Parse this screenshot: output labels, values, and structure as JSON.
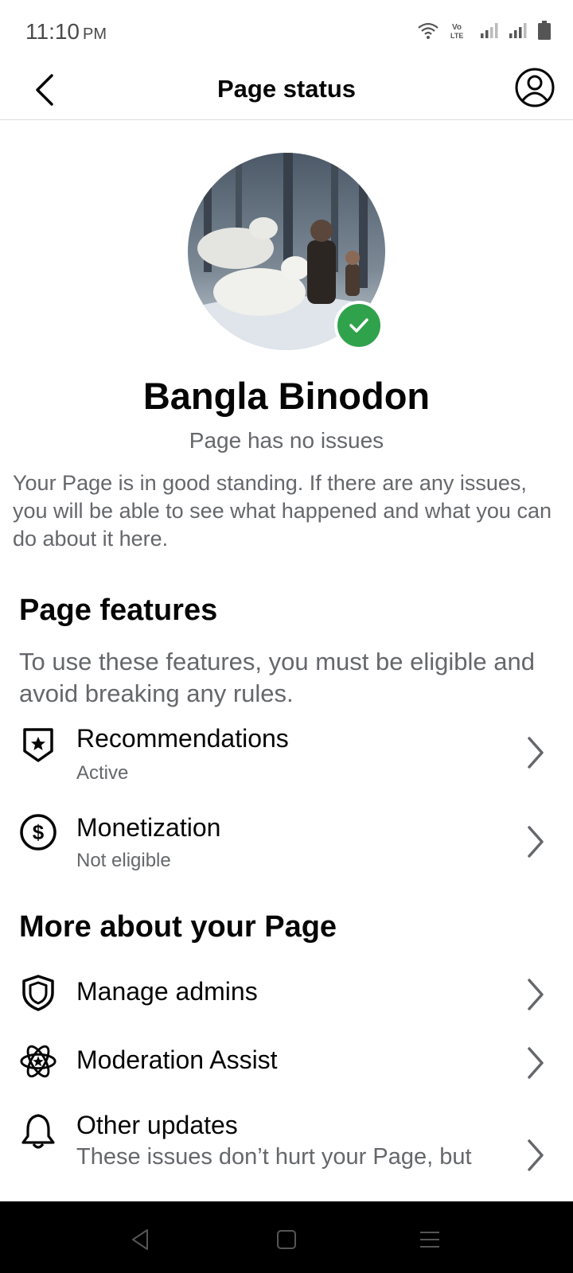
{
  "status_bar": {
    "time": "11:10",
    "ampm": "PM",
    "icons": [
      "wifi-icon",
      "volte-icon",
      "signal-icon",
      "signal-icon",
      "battery-icon"
    ]
  },
  "header": {
    "title": "Page status",
    "back_icon": "chevron-left-icon",
    "profile_icon": "profile-icon"
  },
  "page": {
    "name": "Bangla Binodon",
    "status": "Page has no issues",
    "standing_text": "Your Page is in good standing. If there are any issues, you will be able to see what happened and what you can do about it here."
  },
  "features": {
    "title": "Page features",
    "description": "To use these features, you must be eligible and avoid breaking any rules.",
    "items": [
      {
        "label": "Recommendations",
        "sub": "Active",
        "icon": "badge-star-icon"
      },
      {
        "label": "Monetization",
        "sub": "Not eligible",
        "icon": "dollar-circle-icon"
      }
    ]
  },
  "more": {
    "title": "More about your Page",
    "items": [
      {
        "label": "Manage admins",
        "icon": "shield-icon"
      },
      {
        "label": "Moderation Assist",
        "icon": "atom-star-icon"
      },
      {
        "label": "Other updates",
        "sub": "These issues don’t hurt your Page, but",
        "icon": "bell-icon"
      }
    ]
  },
  "nav_bar": {
    "icons": [
      "back-triangle-icon",
      "home-square-icon",
      "menu-lines-icon"
    ]
  },
  "colors": {
    "primary_text": "#050505",
    "secondary_text": "#65676b",
    "verified_green": "#31a24c"
  }
}
